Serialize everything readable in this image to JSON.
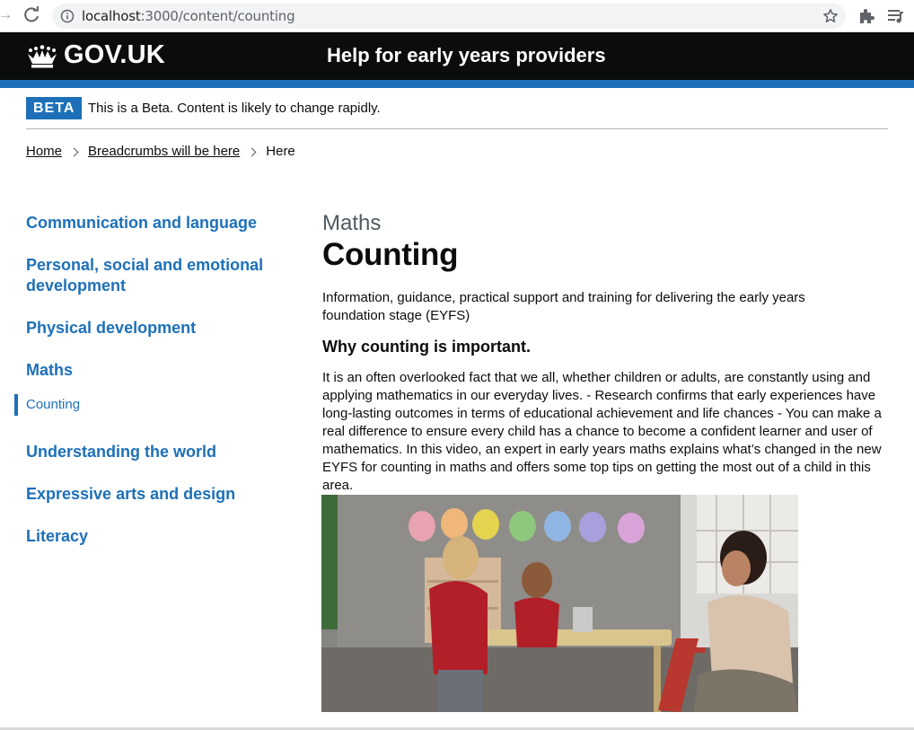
{
  "browser": {
    "url_host": "localhost",
    "url_path": ":3000/content/counting"
  },
  "header": {
    "logo_text": "GOV.UK",
    "service_name": "Help for early years providers"
  },
  "phase_banner": {
    "tag": "BETA",
    "text": "This is a Beta. Content is likely to change rapidly."
  },
  "breadcrumbs": [
    {
      "label": "Home"
    },
    {
      "label": "Breadcrumbs will be here"
    },
    {
      "label": "Here"
    }
  ],
  "sidenav": {
    "items": [
      {
        "label": "Communication and language"
      },
      {
        "label": "Personal, social and emotional development"
      },
      {
        "label": "Physical development"
      },
      {
        "label": "Maths"
      },
      {
        "label": "Understanding the world"
      },
      {
        "label": "Expressive arts and design"
      },
      {
        "label": "Literacy"
      }
    ],
    "current_sub": {
      "label": "Counting"
    }
  },
  "content": {
    "caption": "Maths",
    "title": "Counting",
    "lede": "Information, guidance, practical support and training for delivering the early years foundation stage (EYFS)",
    "subheading": "Why counting is important.",
    "body": "It is an often overlooked fact that we all, whether children or adults, are constantly using and applying mathematics in our everyday lives. - Research confirms that early experiences have long-lasting outcomes in terms of educational achievement and life chances - You can make a real difference to ensure every child has a chance to become a confident learner and user of mathematics. In this video, an expert in early years maths explains what’s changed in the new EYFS for counting in maths and offers some top tips on getting the most out of a child in this area."
  },
  "icons": {
    "forward": "forward-arrow-icon",
    "reload": "reload-icon",
    "info": "info-icon",
    "star": "bookmark-star-icon",
    "extensions": "puzzle-extension-icon",
    "media": "media-queue-icon",
    "crown": "crown-icon"
  },
  "colors": {
    "header_bg": "#0b0c0c",
    "brand_blue": "#1d70b8",
    "text": "#0b0c0c",
    "secondary_text": "#505a5f"
  }
}
